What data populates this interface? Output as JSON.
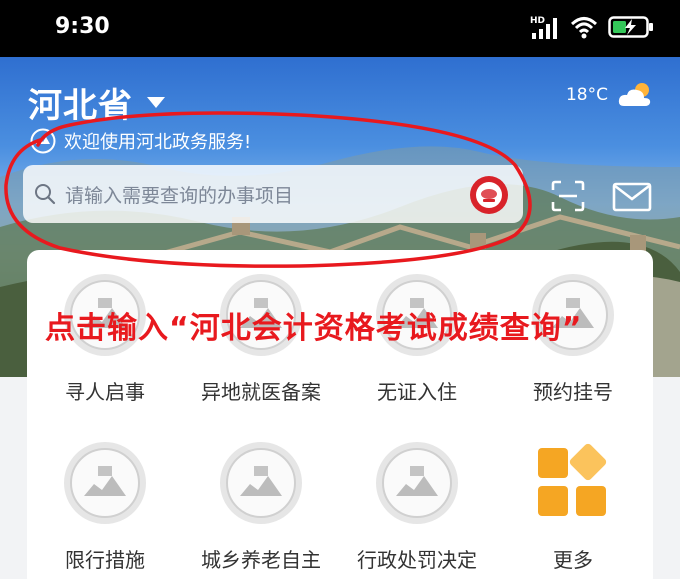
{
  "status_bar": {
    "time": "9:30",
    "network": "HD",
    "battery_icon": "battery-charging-icon"
  },
  "header": {
    "province": "河北省",
    "temperature": "18°C",
    "weather_icon": "cloud-sun-icon",
    "welcome": "欢迎使用河北政务服务!"
  },
  "search": {
    "placeholder": "请输入需要查询的办事项目"
  },
  "annotation": {
    "instruction": "点击输入“河北会计资格考试成绩查询”",
    "color": "#e8191e"
  },
  "services": {
    "row1": [
      "寻人启事",
      "异地就医备案",
      "无证入住",
      "预约挂号"
    ],
    "row2": [
      "限行措施",
      "城乡养老自主",
      "行政处罚决定",
      "更多"
    ]
  },
  "colors": {
    "more_icon": "#f5a623",
    "instruction": "#e8191e"
  }
}
